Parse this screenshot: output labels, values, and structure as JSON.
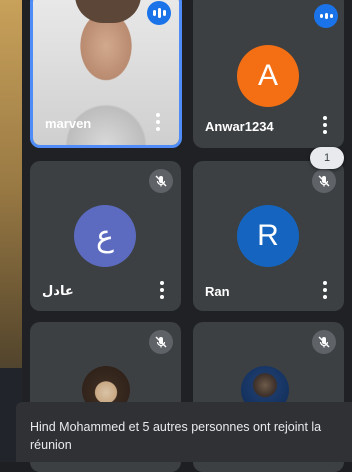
{
  "participants": [
    {
      "name": "marven",
      "type": "video",
      "state": "speaking"
    },
    {
      "name": "Anwar1234",
      "initial": "A",
      "avatar_color": "#f46f14",
      "state": "speaking"
    },
    {
      "name": "عادل",
      "initial": "ع",
      "avatar_color": "#5c6bc0",
      "state": "muted"
    },
    {
      "name": "Ran",
      "initial": "R",
      "avatar_color": "#1565c0",
      "state": "muted"
    },
    {
      "name": "",
      "type": "video",
      "state": "muted"
    },
    {
      "name": "",
      "type": "video",
      "state": "muted"
    }
  ],
  "overflow_badge": "1",
  "toast": {
    "message": "Hind Mohammed et 5 autres personnes ont rejoint la réunion"
  },
  "icons": {
    "speaking": "audio-bars-icon",
    "muted": "mic-off-icon",
    "menu": "more-vert-icon"
  },
  "colors": {
    "tile": "#3c4043",
    "active_border": "#4f8cf7",
    "speaking_badge": "#1a73e8",
    "toast": "#303134"
  }
}
